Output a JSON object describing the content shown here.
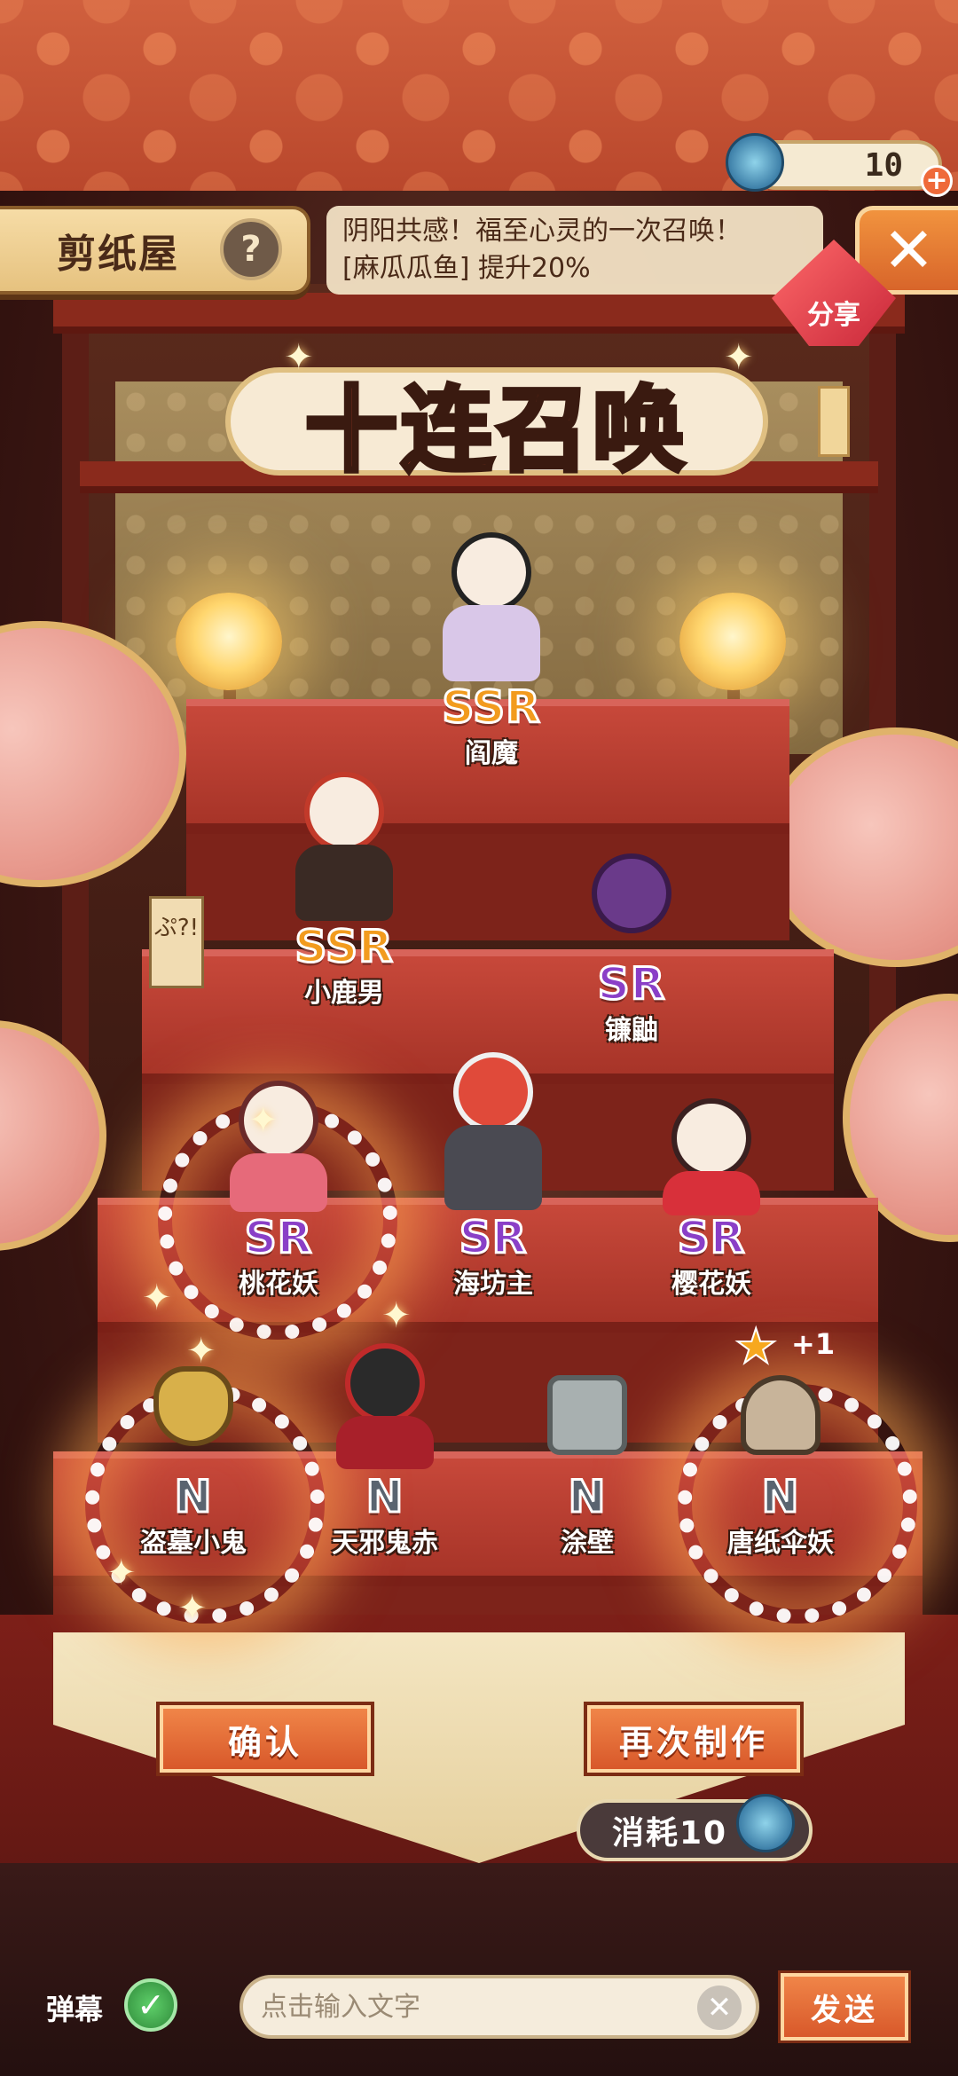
{
  "header": {
    "title": "剪纸屋",
    "help_icon": "question-icon",
    "notice_line1": "阴阳共感！福至心灵的一次召唤！",
    "notice_line2": "[麻瓜瓜鱼] 提升20%",
    "currency_value": "10",
    "share_label": "分享"
  },
  "banner": {
    "title": "十连召唤"
  },
  "paper_slip": {
    "text": "ぷ?!"
  },
  "characters": [
    {
      "rarity": "SSR",
      "name": "阎魔",
      "color": "#f29b1e"
    },
    {
      "rarity": "SSR",
      "name": "小鹿男",
      "color": "#f29b1e"
    },
    {
      "rarity": "SR",
      "name": "镰鼬",
      "color": "#8a3fc7"
    },
    {
      "rarity": "SR",
      "name": "桃花妖",
      "color": "#8a3fc7"
    },
    {
      "rarity": "SR",
      "name": "海坊主",
      "color": "#8a3fc7"
    },
    {
      "rarity": "SR",
      "name": "樱花妖",
      "color": "#8a3fc7"
    },
    {
      "rarity": "N",
      "name": "盗墓小鬼",
      "color": "#5a6470"
    },
    {
      "rarity": "N",
      "name": "天邪鬼赤",
      "color": "#5a6470"
    },
    {
      "rarity": "N",
      "name": "涂壁",
      "color": "#5a6470"
    },
    {
      "rarity": "N",
      "name": "唐纸伞妖",
      "color": "#5a6470"
    }
  ],
  "bonus": {
    "text": "+1"
  },
  "actions": {
    "confirm_label": "确认",
    "again_label": "再次制作",
    "cost_label": "消耗10"
  },
  "chat": {
    "danmu_label": "弹幕",
    "input_placeholder": "点击输入文字",
    "send_label": "发送"
  }
}
